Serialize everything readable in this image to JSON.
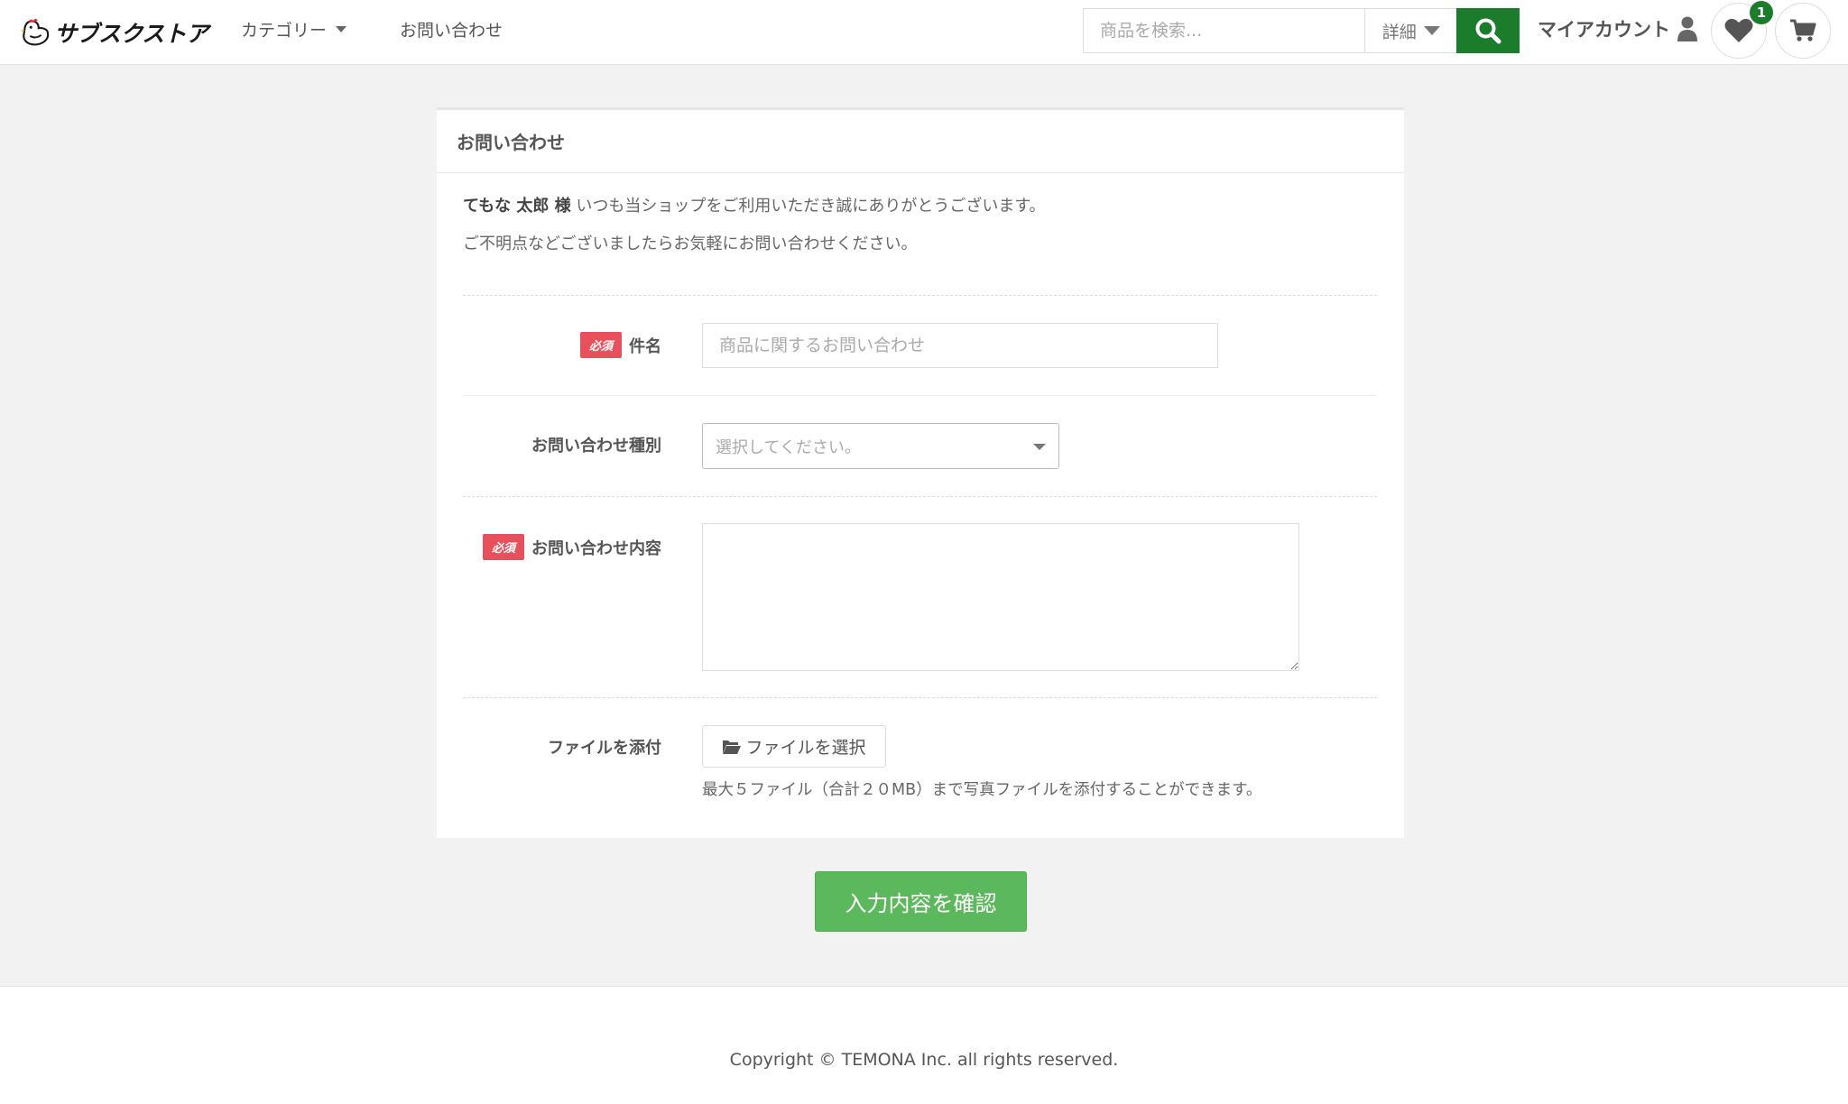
{
  "header": {
    "logo_text": "サブスクストア",
    "nav": {
      "category_label": "カテゴリー",
      "contact_label": "お問い合わせ"
    },
    "search": {
      "placeholder": "商品を検索...",
      "detail_label": "詳細"
    },
    "account_label": "マイアカウント",
    "favorites_count": "1",
    "accent_color": "#1b7d2b"
  },
  "card": {
    "title": "お問い合わせ",
    "greeting_name": "てもな 太郎 様",
    "greeting_text": " いつも当ショップをご利用いただき誠にありがとうございます。",
    "greeting_line2": "ご不明点などございましたらお気軽にお問い合わせください。"
  },
  "form": {
    "required_badge": "必須",
    "subject": {
      "label": "件名",
      "placeholder": "商品に関するお問い合わせ"
    },
    "type": {
      "label": "お問い合わせ種別",
      "placeholder": "選択してください。"
    },
    "body": {
      "label": "お問い合わせ内容",
      "value": ""
    },
    "attachment": {
      "label": "ファイルを添付",
      "button_label": "ファイルを選択",
      "note": "最大５ファイル（合計２０MB）まで写真ファイルを添付することができます。"
    },
    "submit_label": "入力内容を確認"
  },
  "footer": {
    "copyright": "Copyright © TEMONA Inc. all rights reserved."
  },
  "colors": {
    "required": "#e8505b",
    "submit": "#5cb85c"
  }
}
